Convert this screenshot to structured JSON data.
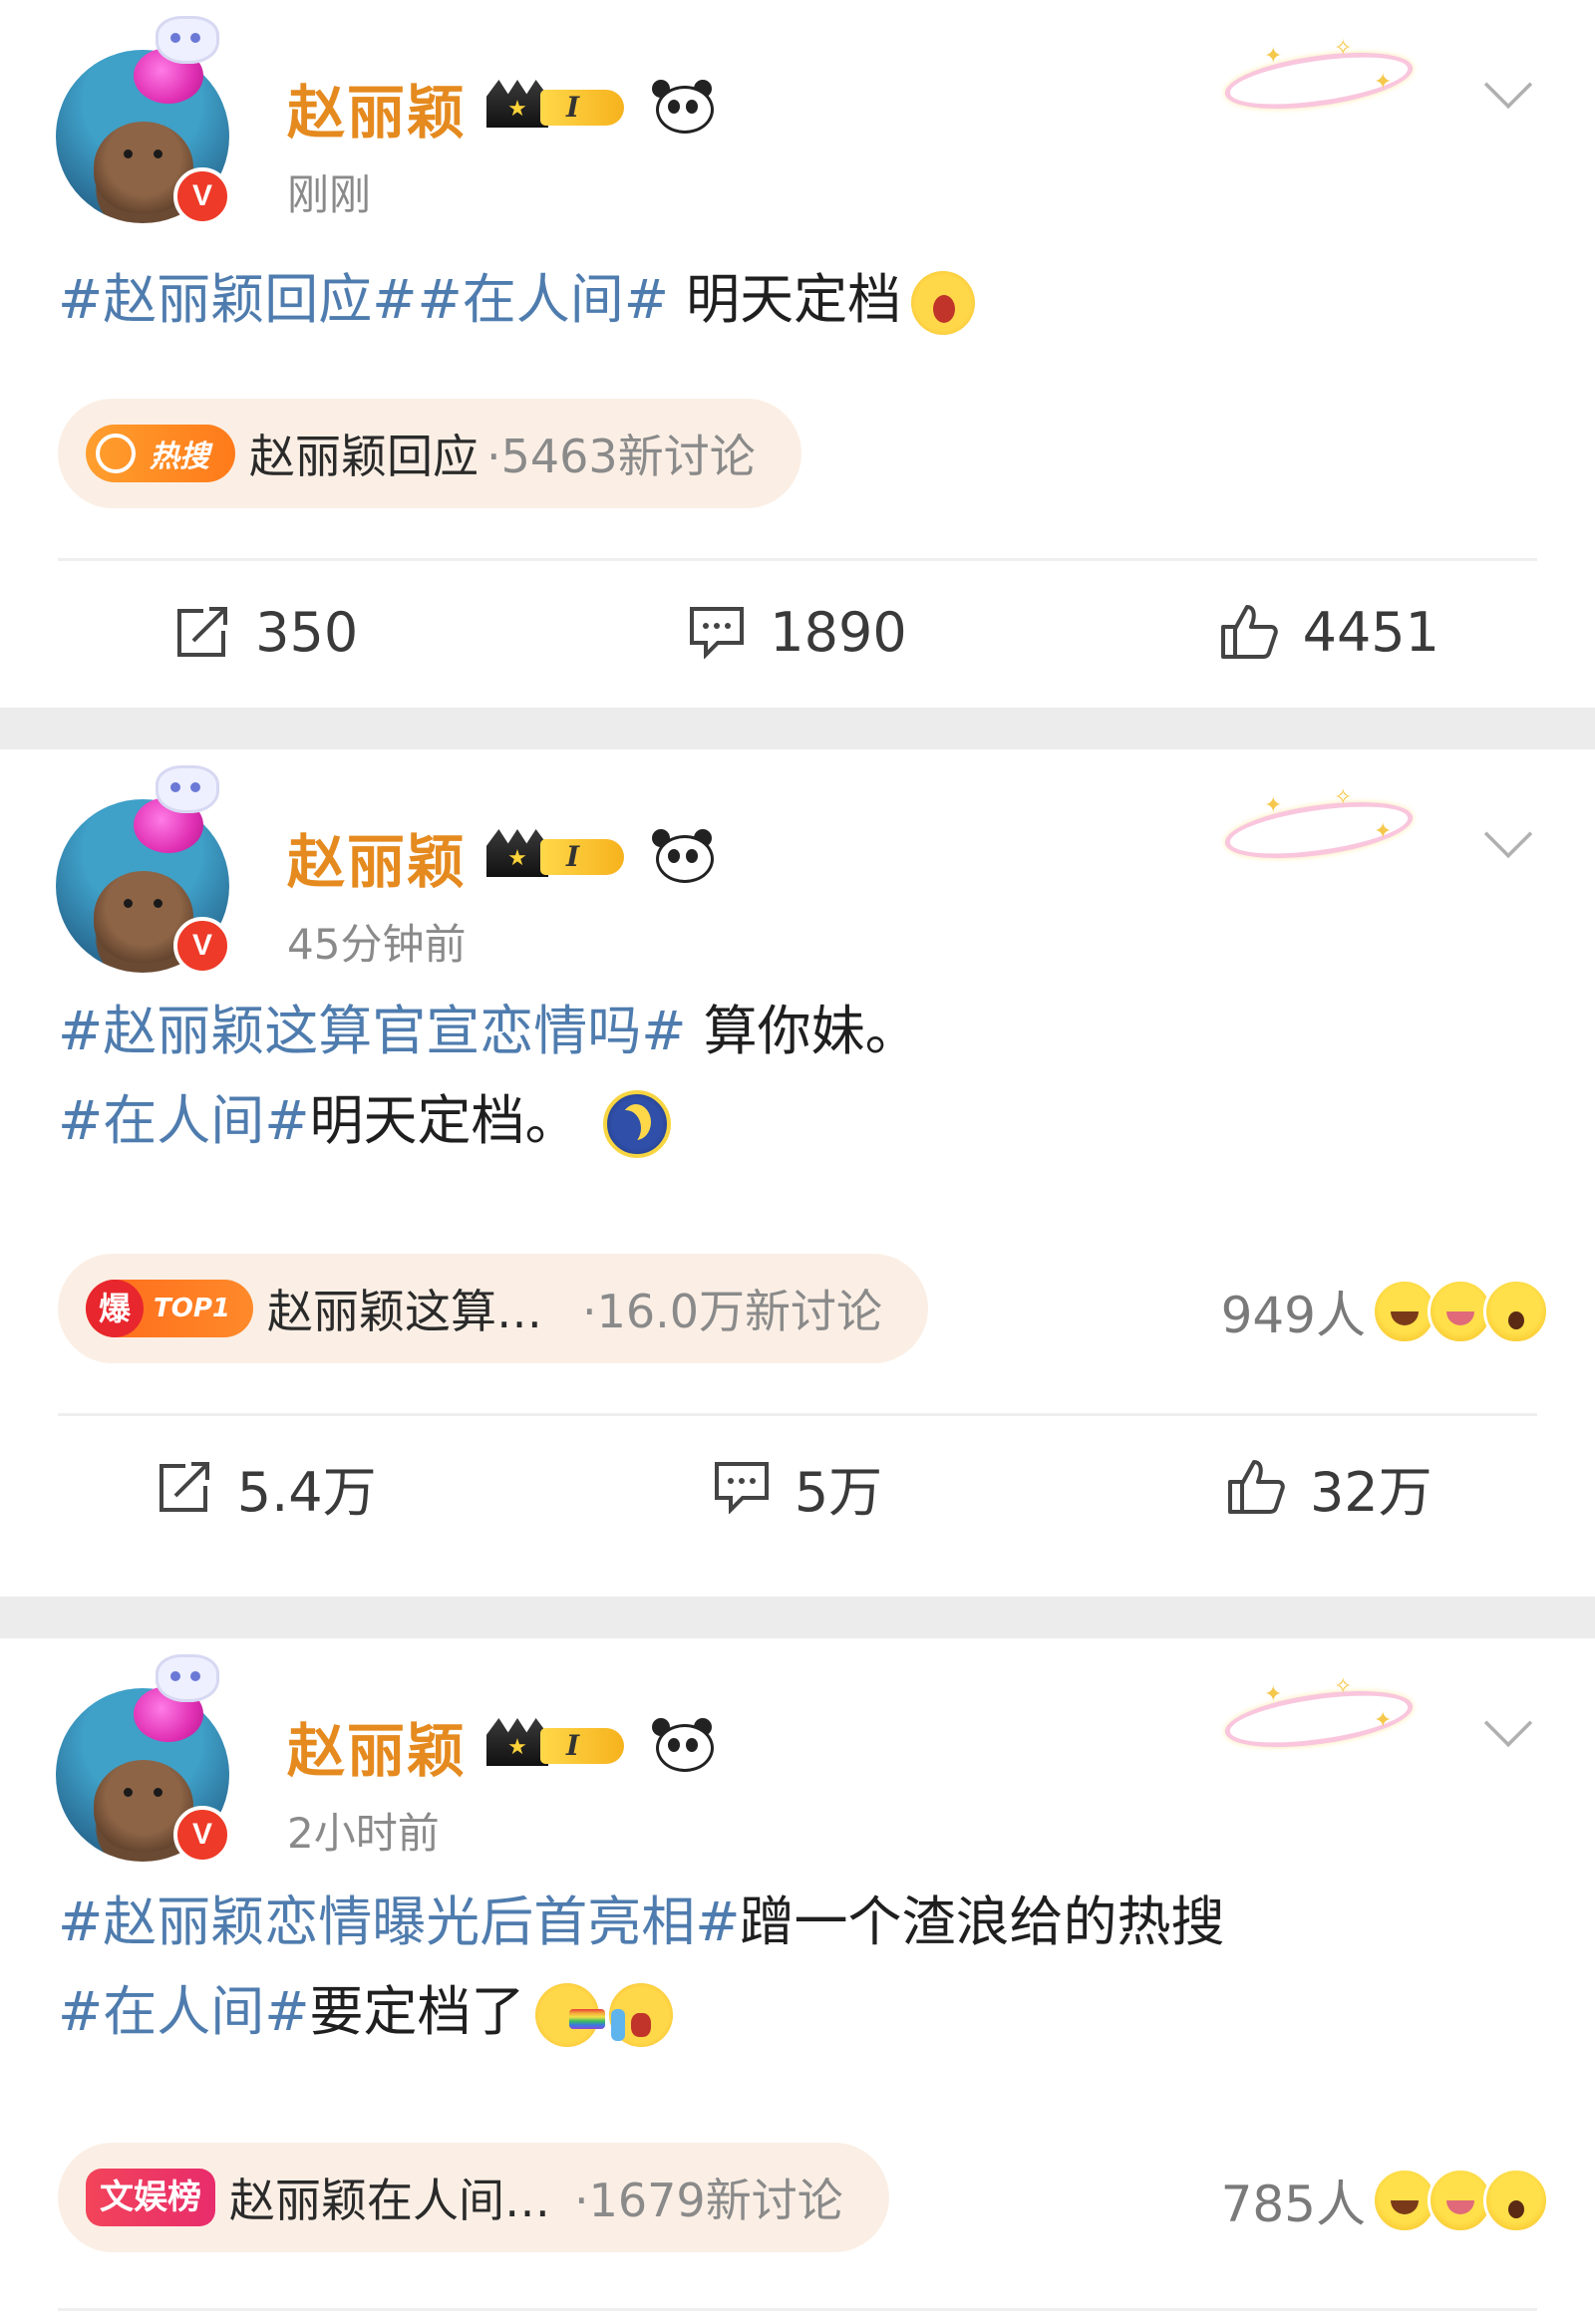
{
  "colors": {
    "name": "#e58a1f",
    "hashtag": "#4f7cae",
    "meta": "#8a8a8a",
    "separator": "#ececec",
    "vbadge": "#ee3a28"
  },
  "posts": [
    {
      "author": "赵丽颖",
      "time": "刚刚",
      "level": "I",
      "lines": [
        [
          {
            "t": "#赵丽颖回应##在人间#",
            "tag": true
          },
          {
            "t": " 明天定档",
            "tag": false
          }
        ]
      ],
      "emoji": [
        "yawn-emoji"
      ],
      "topic": {
        "badge_type": "hot",
        "badge_text": "热搜",
        "label": "赵丽颖回应",
        "meta": "·5463新讨论"
      },
      "people": null,
      "actions": {
        "repost": "350",
        "comment": "1890",
        "like": "4451"
      }
    },
    {
      "author": "赵丽颖",
      "time": "45分钟前",
      "level": "I",
      "lines": [
        [
          {
            "t": "#赵丽颖这算官宣恋情吗#",
            "tag": true
          },
          {
            "t": " 算你妹。",
            "tag": false
          }
        ],
        [
          {
            "t": "#在人间#",
            "tag": true
          },
          {
            "t": "明天定档。",
            "tag": false
          }
        ]
      ],
      "emoji": [
        "moon-emoji"
      ],
      "topic": {
        "badge_type": "boom",
        "badge_boom": "爆",
        "badge_text": "TOP1",
        "label": "赵丽颖这算…",
        "meta": "·16.0万新讨论"
      },
      "people": "949人",
      "actions": {
        "repost": "5.4万",
        "comment": "5万",
        "like": "32万"
      }
    },
    {
      "author": "赵丽颖",
      "time": "2小时前",
      "level": "I",
      "lines": [
        [
          {
            "t": "#赵丽颖恋情曝光后首亮相#",
            "tag": true
          },
          {
            "t": "蹭一个渣浪给的热搜",
            "tag": false
          }
        ],
        [
          {
            "t": "#在人间#",
            "tag": true
          },
          {
            "t": "要定档了",
            "tag": false
          }
        ]
      ],
      "emoji": [
        "rainbow-emoji",
        "cry-emoji"
      ],
      "topic": {
        "badge_type": "ent",
        "badge_text": "文娱榜",
        "label": "赵丽颖在人间…",
        "meta": "·1679新讨论"
      },
      "people": "785人",
      "actions": null
    }
  ]
}
